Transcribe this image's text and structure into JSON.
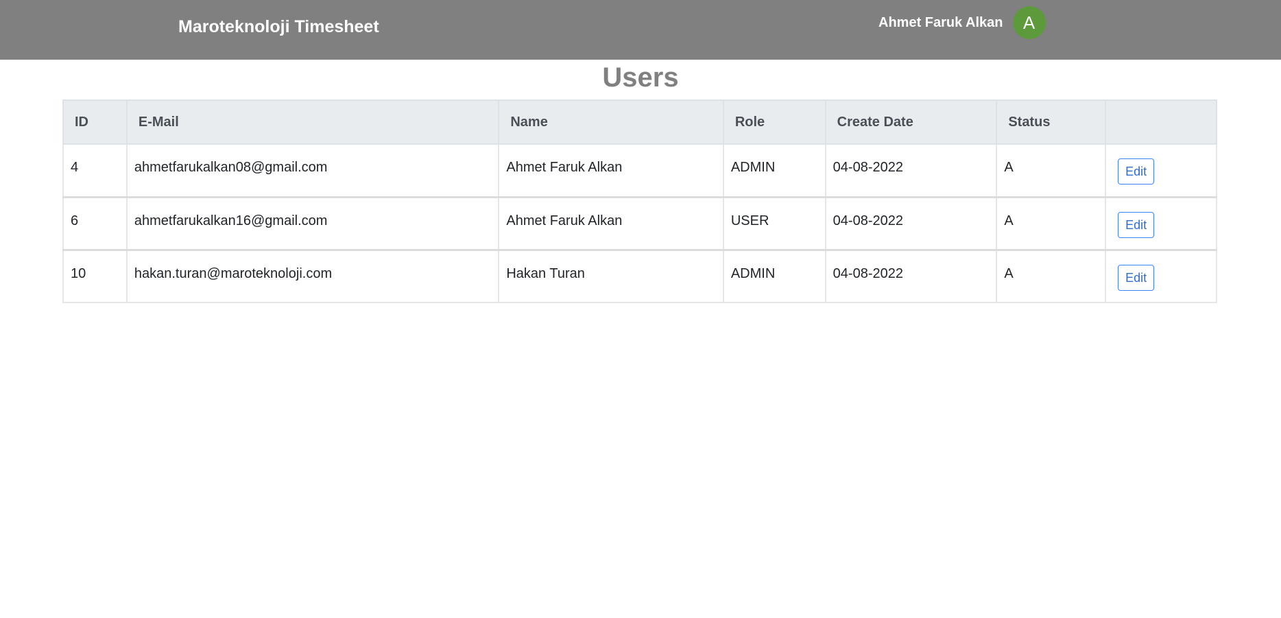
{
  "header": {
    "app_title": "Maroteknoloji Timesheet",
    "user_name": "Ahmet Faruk Alkan",
    "avatar_initial": "A",
    "background_color": "#808080",
    "avatar_color": "#5d9a3c"
  },
  "page": {
    "title": "Users"
  },
  "table": {
    "columns": [
      "ID",
      "E-Mail",
      "Name",
      "Role",
      "Create Date",
      "Status",
      ""
    ],
    "rows": [
      {
        "id": "4",
        "email": "ahmetfarukalkan08@gmail.com",
        "name": "Ahmet Faruk Alkan",
        "role": "ADMIN",
        "create_date": "04-08-2022",
        "status": "A",
        "action": "Edit"
      },
      {
        "id": "6",
        "email": "ahmetfarukalkan16@gmail.com",
        "name": "Ahmet Faruk Alkan",
        "role": "USER",
        "create_date": "04-08-2022",
        "status": "A",
        "action": "Edit"
      },
      {
        "id": "10",
        "email": "hakan.turan@maroteknoloji.com",
        "name": "Hakan Turan",
        "role": "ADMIN",
        "create_date": "04-08-2022",
        "status": "A",
        "action": "Edit"
      }
    ]
  }
}
